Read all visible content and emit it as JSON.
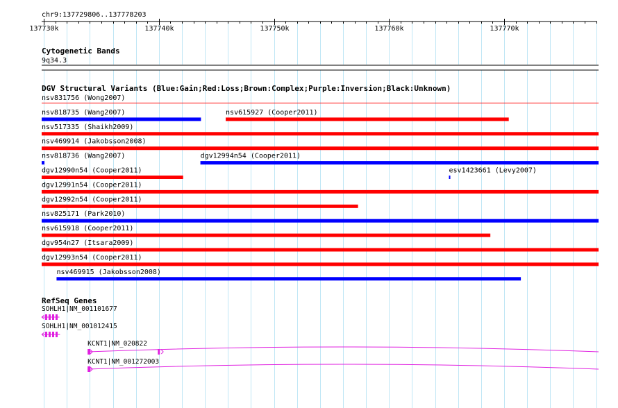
{
  "region": {
    "label": "chr9:137729806..137778203",
    "start": 137729806,
    "end": 137778203,
    "ticks": [
      {
        "pos": 137730000,
        "label": "137730k"
      },
      {
        "pos": 137740000,
        "label": "137740k"
      },
      {
        "pos": 137750000,
        "label": "137750k"
      },
      {
        "pos": 137760000,
        "label": "137760k"
      },
      {
        "pos": 137770000,
        "label": "137770k"
      }
    ]
  },
  "colors": {
    "gain": "#0000ff",
    "loss": "#ff0000",
    "gene": "#e020e0",
    "grid": "#bfe6f5"
  },
  "cytoband": {
    "title": "Cytogenetic Bands",
    "band": "9q34.3"
  },
  "dgv": {
    "title": "DGV Structural Variants (Blue:Gain;Red:Loss;Brown:Complex;Purple:Inversion;Black:Unknown)",
    "variants": [
      {
        "label": "nsv831756 (Wong2007)",
        "type": "loss",
        "start": 137729800,
        "end": 137778203,
        "thin": true
      },
      {
        "label": "nsv818735 (Wang2007)",
        "type": "gain",
        "start": 137729800,
        "end": 137743650
      },
      {
        "label": "nsv615927 (Cooper2011)",
        "type": "loss",
        "start": 137745800,
        "end": 137770400
      },
      {
        "label": "nsv517335 (Shaikh2009)",
        "type": "loss",
        "start": 137729800,
        "end": 137778203
      },
      {
        "label": "nsv469914 (Jakobsson2008)",
        "type": "loss",
        "start": 137729800,
        "end": 137778203
      },
      {
        "label": "nsv818736 (Wang2007)",
        "type": "gain",
        "start": 137729800,
        "end": 137730050
      },
      {
        "label": "dgv12994n54 (Cooper2011)",
        "type": "gain",
        "start": 137743600,
        "end": 137778203
      },
      {
        "label": "dgv12990n54 (Cooper2011)",
        "type": "loss",
        "start": 137729800,
        "end": 137742100
      },
      {
        "label": "esv1423661 (Levy2007)",
        "type": "gain",
        "start": 137765200,
        "end": 137765300
      },
      {
        "label": "dgv12991n54 (Cooper2011)",
        "type": "loss",
        "start": 137729800,
        "end": 137778203
      },
      {
        "label": "dgv12992n54 (Cooper2011)",
        "type": "loss",
        "start": 137729800,
        "end": 137757300
      },
      {
        "label": "nsv825171 (Park2010)",
        "type": "gain",
        "start": 137729800,
        "end": 137778203
      },
      {
        "label": "nsv615918 (Cooper2011)",
        "type": "loss",
        "start": 137729800,
        "end": 137768800
      },
      {
        "label": "dgv954n27 (Itsara2009)",
        "type": "loss",
        "start": 137729800,
        "end": 137778203
      },
      {
        "label": "dgv12993n54 (Cooper2011)",
        "type": "loss",
        "start": 137729800,
        "end": 137778203
      },
      {
        "label": "nsv469915 (Jakobsson2008)",
        "type": "gain",
        "start": 137731100,
        "end": 137771450
      }
    ]
  },
  "refseq": {
    "title": "RefSeq Genes",
    "genes": [
      {
        "label": "SOHLH1|NM_001101677",
        "start": 137729800,
        "end": 137731350,
        "strand": "-"
      },
      {
        "label": "SOHLH1|NM_001012415",
        "start": 137729800,
        "end": 137731400,
        "strand": "-"
      },
      {
        "label": "KCNT1|NM_020822",
        "start": 137733800,
        "end": 137778203,
        "strand": "+"
      },
      {
        "label": "KCNT1|NM_001272003",
        "start": 137733800,
        "end": 137778203,
        "strand": "+"
      }
    ]
  }
}
